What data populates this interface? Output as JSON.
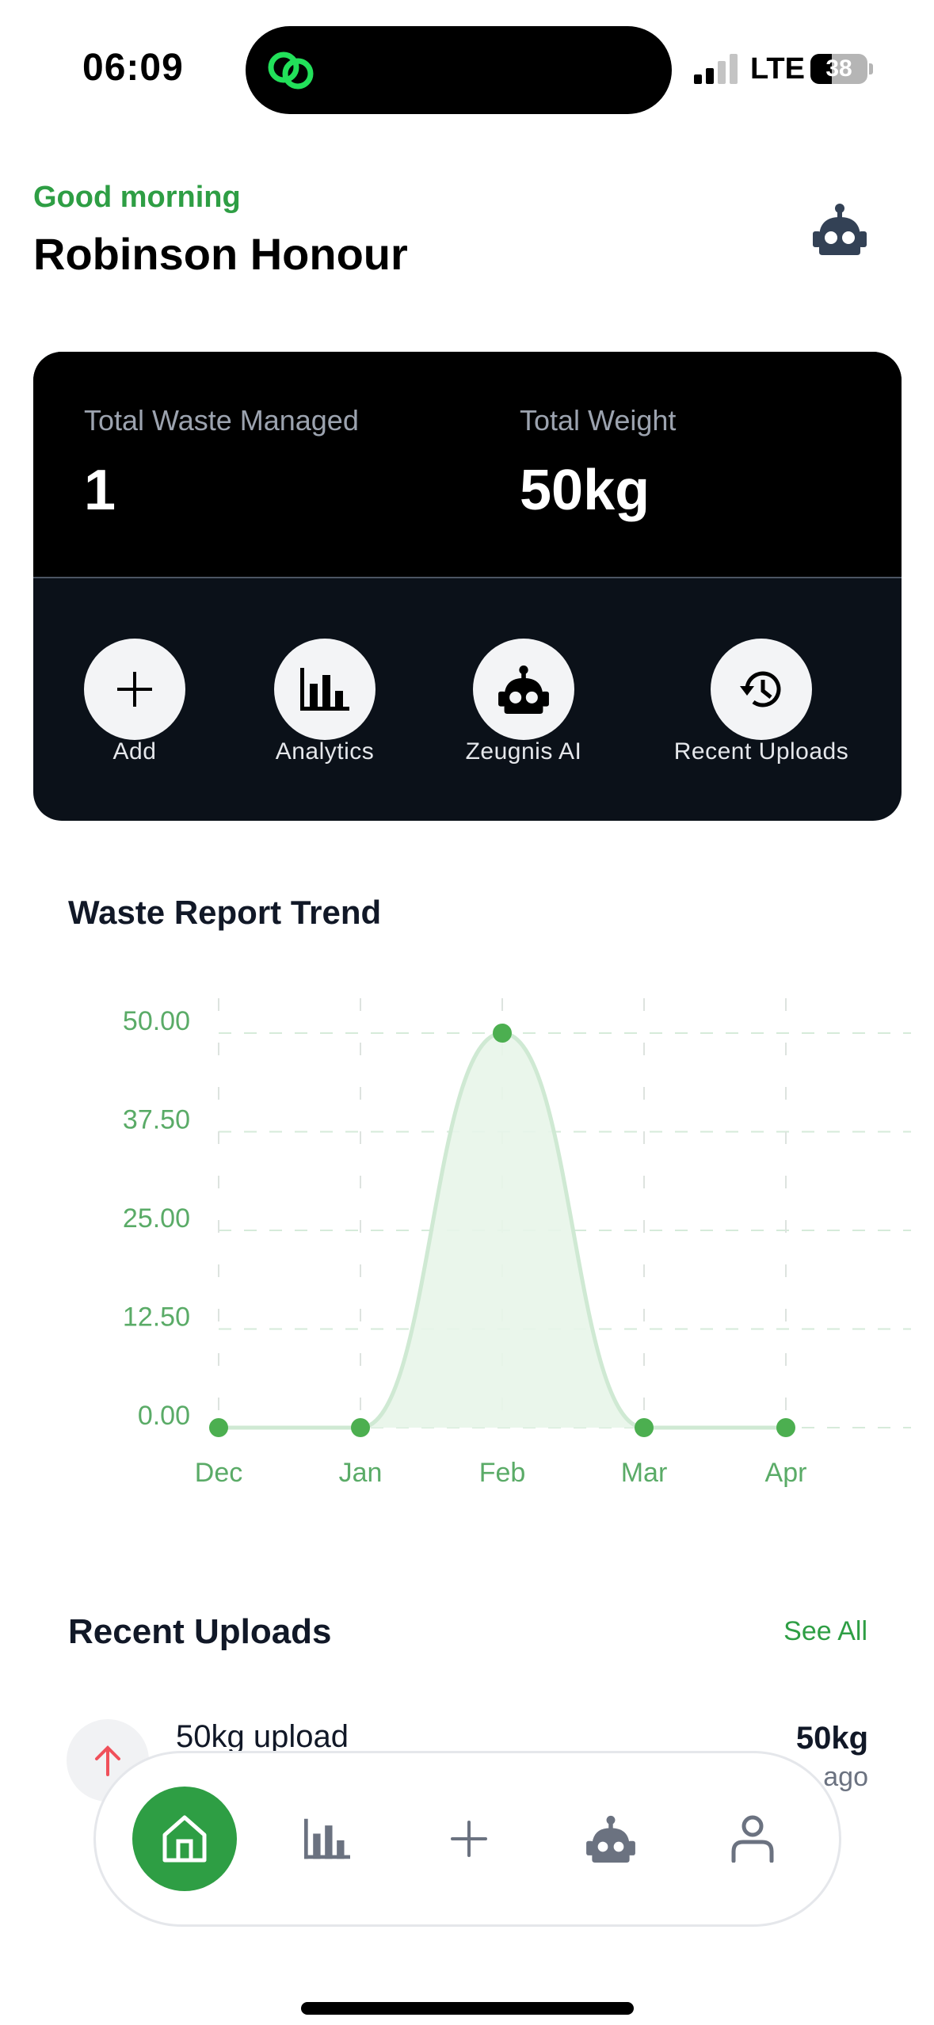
{
  "status_bar": {
    "time": "06:09",
    "network": "LTE",
    "battery_percent": "38",
    "battery_level": 0.38,
    "signal_bars_active": 2,
    "signal_bars_total": 4,
    "island_icon": "link-icon",
    "island_icon_color": "#22e05a"
  },
  "header": {
    "greeting": "Good morning",
    "user_name": "Robinson Honour",
    "assistant_icon": "robot-icon"
  },
  "stats": {
    "items": [
      {
        "label": "Total Waste Managed",
        "value": "1"
      },
      {
        "label": "Total Weight",
        "value": "50kg"
      }
    ]
  },
  "quick_actions": [
    {
      "label": "Add",
      "icon": "plus-icon"
    },
    {
      "label": "Analytics",
      "icon": "bar-chart-icon"
    },
    {
      "label": "Zeugnis AI",
      "icon": "robot-icon"
    },
    {
      "label": "Recent Uploads",
      "icon": "history-icon"
    }
  ],
  "chart_section": {
    "title": "Waste Report Trend"
  },
  "chart_data": {
    "type": "area",
    "title": "Waste Report Trend",
    "categories": [
      "Dec",
      "Jan",
      "Feb",
      "Mar",
      "Apr"
    ],
    "values": [
      0,
      0,
      50,
      0,
      0
    ],
    "xlabel": "",
    "ylabel": "",
    "ylim": [
      0,
      50
    ],
    "yticks": [
      "0.00",
      "12.50",
      "25.00",
      "37.50",
      "50.00"
    ],
    "ytick_values": [
      0,
      12.5,
      25,
      37.5,
      50
    ],
    "grid": true,
    "smooth": true,
    "line_color": "#4caf50",
    "fill_color": "#e8f5e9"
  },
  "recent_uploads": {
    "title": "Recent Uploads",
    "see_all_label": "See All",
    "items": [
      {
        "name": "50kg upload",
        "weight": "50kg",
        "time": "ago",
        "icon": "arrow-up-icon",
        "icon_color": "#f0505a"
      }
    ]
  },
  "bottom_nav": {
    "items": [
      {
        "name": "home",
        "icon": "home-icon",
        "active": true
      },
      {
        "name": "analytics",
        "icon": "bar-chart-icon",
        "active": false
      },
      {
        "name": "add",
        "icon": "plus-icon",
        "active": false
      },
      {
        "name": "assistant",
        "icon": "robot-icon",
        "active": false
      },
      {
        "name": "profile",
        "icon": "user-icon",
        "active": false
      }
    ]
  },
  "colors": {
    "brand_green": "#2e9e44",
    "dark_card": "#0b1119",
    "nav_icon": "#6b7280"
  }
}
